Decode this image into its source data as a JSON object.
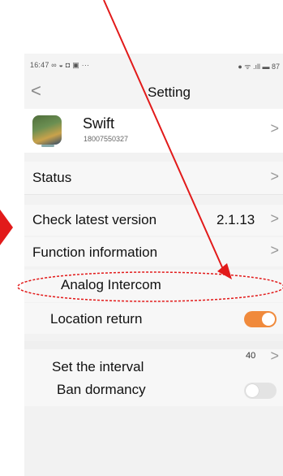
{
  "status_bar": {
    "time": "16:47 ∞ ◒ ◘ ▣ ···",
    "indicators": "● ᯤ .ıll ▬ 87"
  },
  "nav": {
    "back_glyph": "<",
    "title": "Setting"
  },
  "profile": {
    "name": "Swift",
    "phone": "18007550327",
    "chevron": ">"
  },
  "settings": {
    "status": {
      "label": "Status",
      "chevron": ">"
    },
    "check_version": {
      "label": "Check latest version",
      "value": "2.1.13",
      "chevron": ">"
    },
    "function_info": {
      "label": "Function information",
      "chevron": ">"
    },
    "analog_intercom": {
      "label": "Analog Intercom"
    },
    "location_return": {
      "label": "Location return",
      "enabled": true
    },
    "set_interval": {
      "label": "Set the interval",
      "value": "40",
      "chevron": ">"
    },
    "ban_dormancy": {
      "label": "Ban dormancy",
      "enabled": false
    }
  },
  "colors": {
    "toggle_on": "#f08a3c",
    "annotation_red": "#e21a1a"
  }
}
